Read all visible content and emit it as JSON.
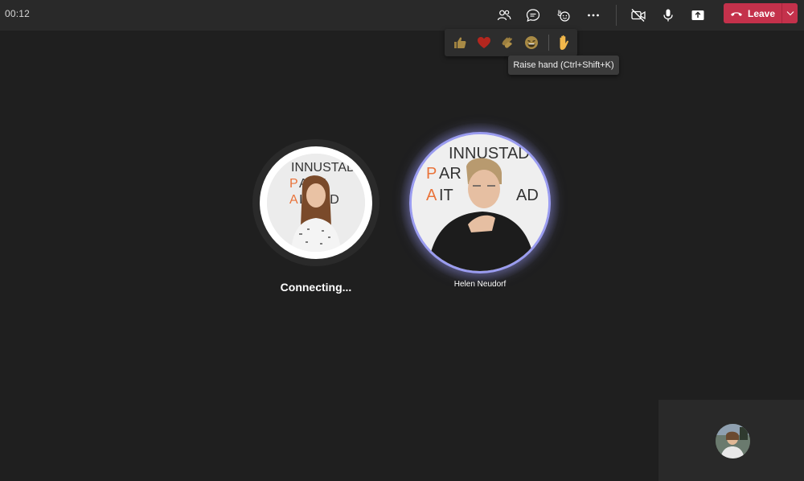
{
  "call": {
    "timer": "00:12"
  },
  "toolbar": {
    "people_icon": "people-icon",
    "chat_icon": "chat-icon",
    "reactions_icon": "reactions-icon",
    "more_icon": "more-actions-icon",
    "camera_icon": "camera-off-icon",
    "mic_icon": "microphone-icon",
    "share_icon": "share-screen-icon",
    "leave_label": "Leave",
    "leave_color": "#c4314b"
  },
  "reactions": {
    "items": [
      {
        "name": "like",
        "icon": "thumbs-up-icon"
      },
      {
        "name": "heart",
        "icon": "heart-icon"
      },
      {
        "name": "applause",
        "icon": "clapping-hands-icon"
      },
      {
        "name": "laugh",
        "icon": "laughing-face-icon"
      },
      {
        "name": "raise-hand",
        "icon": "raised-hand-icon"
      }
    ],
    "tooltip": "Raise hand (Ctrl+Shift+K)"
  },
  "participants": [
    {
      "status": "Connecting..."
    },
    {
      "name": "Helen Neudorf",
      "accent": "#9a9cf0"
    }
  ],
  "self_view": {
    "icon": "self-avatar"
  }
}
